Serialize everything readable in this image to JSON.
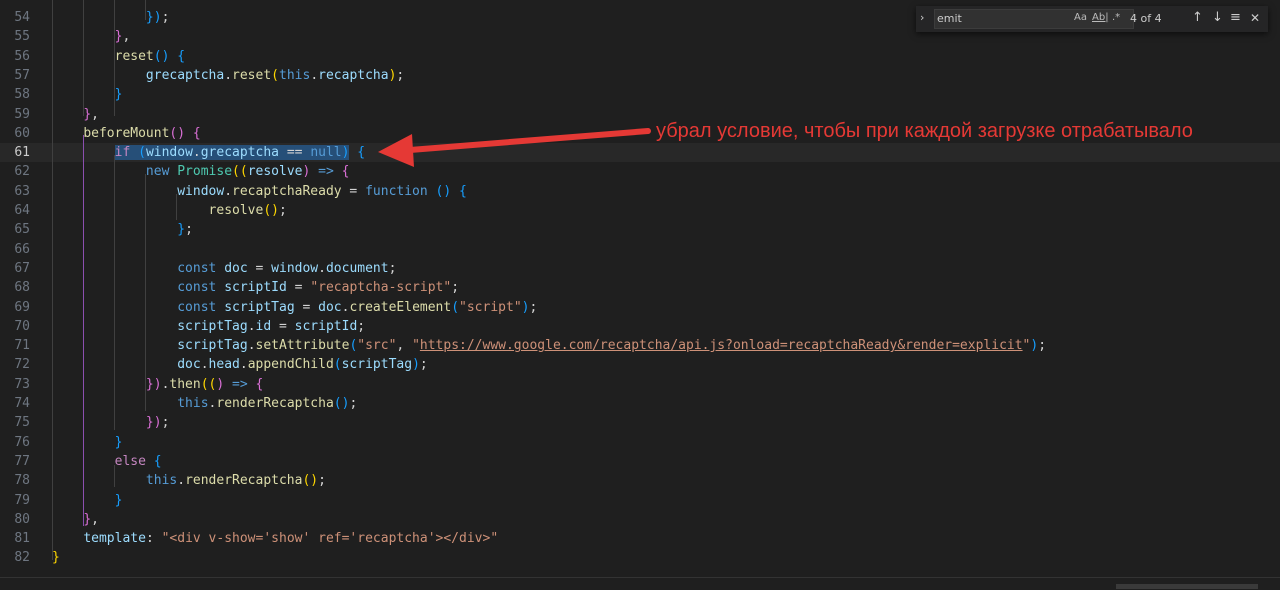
{
  "editor": {
    "lines": [
      {
        "num": "54",
        "current": false,
        "indent": 0,
        "tokens": [
          {
            "t": "            ",
            "c": ""
          },
          {
            "t": "})",
            "c": "p3"
          },
          {
            "t": ";",
            "c": ""
          }
        ]
      },
      {
        "num": "55",
        "current": false,
        "tokens": [
          {
            "t": "        ",
            "c": ""
          },
          {
            "t": "}",
            "c": "p2"
          },
          {
            "t": ",",
            "c": ""
          }
        ]
      },
      {
        "num": "56",
        "current": false,
        "tokens": [
          {
            "t": "        ",
            "c": ""
          },
          {
            "t": "reset",
            "c": "f"
          },
          {
            "t": "() ",
            "c": "p3"
          },
          {
            "t": "{",
            "c": "p3"
          }
        ]
      },
      {
        "num": "57",
        "current": false,
        "tokens": [
          {
            "t": "            ",
            "c": ""
          },
          {
            "t": "grecaptcha",
            "c": "v"
          },
          {
            "t": ".",
            "c": ""
          },
          {
            "t": "reset",
            "c": "f"
          },
          {
            "t": "(",
            "c": "p1"
          },
          {
            "t": "this",
            "c": "k"
          },
          {
            "t": ".",
            "c": ""
          },
          {
            "t": "recaptcha",
            "c": "v"
          },
          {
            "t": ")",
            "c": "p1"
          },
          {
            "t": ";",
            "c": ""
          }
        ]
      },
      {
        "num": "58",
        "current": false,
        "tokens": [
          {
            "t": "        ",
            "c": ""
          },
          {
            "t": "}",
            "c": "p3"
          }
        ]
      },
      {
        "num": "59",
        "current": false,
        "tokens": [
          {
            "t": "    ",
            "c": ""
          },
          {
            "t": "}",
            "c": "p2"
          },
          {
            "t": ",",
            "c": ""
          }
        ]
      },
      {
        "num": "60",
        "current": false,
        "tokens": [
          {
            "t": "    ",
            "c": ""
          },
          {
            "t": "beforeMount",
            "c": "f"
          },
          {
            "t": "() ",
            "c": "p2"
          },
          {
            "t": "{",
            "c": "p2"
          }
        ]
      },
      {
        "num": "61",
        "current": true,
        "tokens": [
          {
            "t": "        ",
            "c": ""
          },
          {
            "t": "if ",
            "c": "c",
            "sel": true
          },
          {
            "t": "(",
            "c": "p3",
            "sel": true
          },
          {
            "t": "window",
            "c": "v",
            "sel": true
          },
          {
            "t": ".",
            "c": "",
            "sel": true
          },
          {
            "t": "grecaptcha",
            "c": "v",
            "sel": true
          },
          {
            "t": " == ",
            "c": "",
            "sel": true
          },
          {
            "t": "null",
            "c": "k",
            "sel": true
          },
          {
            "t": ")",
            "c": "p3",
            "sel": true
          },
          {
            "t": " ",
            "c": ""
          },
          {
            "t": "{",
            "c": "p3"
          }
        ]
      },
      {
        "num": "62",
        "current": false,
        "tokens": [
          {
            "t": "            ",
            "c": ""
          },
          {
            "t": "new ",
            "c": "k"
          },
          {
            "t": "Promise",
            "c": "t"
          },
          {
            "t": "((",
            "c": "p1"
          },
          {
            "t": "resolve",
            "c": "v"
          },
          {
            "t": ")",
            "c": "p2"
          },
          {
            "t": " ",
            "c": ""
          },
          {
            "t": "=>",
            "c": "k"
          },
          {
            "t": " ",
            "c": ""
          },
          {
            "t": "{",
            "c": "p2"
          }
        ]
      },
      {
        "num": "63",
        "current": false,
        "tokens": [
          {
            "t": "                ",
            "c": ""
          },
          {
            "t": "window",
            "c": "v"
          },
          {
            "t": ".",
            "c": ""
          },
          {
            "t": "recaptchaReady",
            "c": "f"
          },
          {
            "t": " = ",
            "c": ""
          },
          {
            "t": "function",
            "c": "k"
          },
          {
            "t": " ",
            "c": ""
          },
          {
            "t": "() ",
            "c": "p3"
          },
          {
            "t": "{",
            "c": "p3"
          }
        ]
      },
      {
        "num": "64",
        "current": false,
        "tokens": [
          {
            "t": "                    ",
            "c": ""
          },
          {
            "t": "resolve",
            "c": "f"
          },
          {
            "t": "()",
            "c": "p1"
          },
          {
            "t": ";",
            "c": ""
          }
        ]
      },
      {
        "num": "65",
        "current": false,
        "tokens": [
          {
            "t": "                ",
            "c": ""
          },
          {
            "t": "}",
            "c": "p3"
          },
          {
            "t": ";",
            "c": ""
          }
        ]
      },
      {
        "num": "66",
        "current": false,
        "tokens": []
      },
      {
        "num": "67",
        "current": false,
        "tokens": [
          {
            "t": "                ",
            "c": ""
          },
          {
            "t": "const ",
            "c": "k"
          },
          {
            "t": "doc",
            "c": "v"
          },
          {
            "t": " = ",
            "c": ""
          },
          {
            "t": "window",
            "c": "v"
          },
          {
            "t": ".",
            "c": ""
          },
          {
            "t": "document",
            "c": "v"
          },
          {
            "t": ";",
            "c": ""
          }
        ]
      },
      {
        "num": "68",
        "current": false,
        "tokens": [
          {
            "t": "                ",
            "c": ""
          },
          {
            "t": "const ",
            "c": "k"
          },
          {
            "t": "scriptId",
            "c": "v"
          },
          {
            "t": " = ",
            "c": ""
          },
          {
            "t": "\"recaptcha-script\"",
            "c": "s"
          },
          {
            "t": ";",
            "c": ""
          }
        ]
      },
      {
        "num": "69",
        "current": false,
        "tokens": [
          {
            "t": "                ",
            "c": ""
          },
          {
            "t": "const ",
            "c": "k"
          },
          {
            "t": "scriptTag",
            "c": "v"
          },
          {
            "t": " = ",
            "c": ""
          },
          {
            "t": "doc",
            "c": "v"
          },
          {
            "t": ".",
            "c": ""
          },
          {
            "t": "createElement",
            "c": "f"
          },
          {
            "t": "(",
            "c": "p3"
          },
          {
            "t": "\"script\"",
            "c": "s"
          },
          {
            "t": ")",
            "c": "p3"
          },
          {
            "t": ";",
            "c": ""
          }
        ]
      },
      {
        "num": "70",
        "current": false,
        "tokens": [
          {
            "t": "                ",
            "c": ""
          },
          {
            "t": "scriptTag",
            "c": "v"
          },
          {
            "t": ".",
            "c": ""
          },
          {
            "t": "id",
            "c": "v"
          },
          {
            "t": " = ",
            "c": ""
          },
          {
            "t": "scriptId",
            "c": "v"
          },
          {
            "t": ";",
            "c": ""
          }
        ]
      },
      {
        "num": "71",
        "current": false,
        "tokens": [
          {
            "t": "                ",
            "c": ""
          },
          {
            "t": "scriptTag",
            "c": "v"
          },
          {
            "t": ".",
            "c": ""
          },
          {
            "t": "setAttribute",
            "c": "f"
          },
          {
            "t": "(",
            "c": "p3"
          },
          {
            "t": "\"src\"",
            "c": "s"
          },
          {
            "t": ", ",
            "c": ""
          },
          {
            "t": "\"",
            "c": "s"
          },
          {
            "t": "https://www.google.com/recaptcha/api.js?onload=recaptchaReady&render=explicit",
            "c": "s",
            "u": true
          },
          {
            "t": "\"",
            "c": "s"
          },
          {
            "t": ")",
            "c": "p3"
          },
          {
            "t": ";",
            "c": ""
          }
        ]
      },
      {
        "num": "72",
        "current": false,
        "tokens": [
          {
            "t": "                ",
            "c": ""
          },
          {
            "t": "doc",
            "c": "v"
          },
          {
            "t": ".",
            "c": ""
          },
          {
            "t": "head",
            "c": "v"
          },
          {
            "t": ".",
            "c": ""
          },
          {
            "t": "appendChild",
            "c": "f"
          },
          {
            "t": "(",
            "c": "p3"
          },
          {
            "t": "scriptTag",
            "c": "v"
          },
          {
            "t": ")",
            "c": "p3"
          },
          {
            "t": ";",
            "c": ""
          }
        ]
      },
      {
        "num": "73",
        "current": false,
        "tokens": [
          {
            "t": "            ",
            "c": ""
          },
          {
            "t": "})",
            "c": "p2"
          },
          {
            "t": ".",
            "c": ""
          },
          {
            "t": "then",
            "c": "f"
          },
          {
            "t": "((",
            "c": "p1"
          },
          {
            "t": ")",
            "c": "p2"
          },
          {
            "t": " ",
            "c": ""
          },
          {
            "t": "=>",
            "c": "k"
          },
          {
            "t": " ",
            "c": ""
          },
          {
            "t": "{",
            "c": "p2"
          }
        ]
      },
      {
        "num": "74",
        "current": false,
        "tokens": [
          {
            "t": "                ",
            "c": ""
          },
          {
            "t": "this",
            "c": "k"
          },
          {
            "t": ".",
            "c": ""
          },
          {
            "t": "renderRecaptcha",
            "c": "f"
          },
          {
            "t": "()",
            "c": "p3"
          },
          {
            "t": ";",
            "c": ""
          }
        ]
      },
      {
        "num": "75",
        "current": false,
        "tokens": [
          {
            "t": "            ",
            "c": ""
          },
          {
            "t": "})",
            "c": "p2"
          },
          {
            "t": ";",
            "c": ""
          }
        ]
      },
      {
        "num": "76",
        "current": false,
        "tokens": [
          {
            "t": "        ",
            "c": ""
          },
          {
            "t": "}",
            "c": "p3"
          }
        ]
      },
      {
        "num": "77",
        "current": false,
        "tokens": [
          {
            "t": "        ",
            "c": ""
          },
          {
            "t": "else ",
            "c": "c"
          },
          {
            "t": "{",
            "c": "p3"
          }
        ]
      },
      {
        "num": "78",
        "current": false,
        "tokens": [
          {
            "t": "            ",
            "c": ""
          },
          {
            "t": "this",
            "c": "k"
          },
          {
            "t": ".",
            "c": ""
          },
          {
            "t": "renderRecaptcha",
            "c": "f"
          },
          {
            "t": "()",
            "c": "p1"
          },
          {
            "t": ";",
            "c": ""
          }
        ]
      },
      {
        "num": "79",
        "current": false,
        "tokens": [
          {
            "t": "        ",
            "c": ""
          },
          {
            "t": "}",
            "c": "p3"
          }
        ]
      },
      {
        "num": "80",
        "current": false,
        "tokens": [
          {
            "t": "    ",
            "c": ""
          },
          {
            "t": "}",
            "c": "p2"
          },
          {
            "t": ",",
            "c": ""
          }
        ]
      },
      {
        "num": "81",
        "current": false,
        "tokens": [
          {
            "t": "    ",
            "c": ""
          },
          {
            "t": "template",
            "c": "v"
          },
          {
            "t": ": ",
            "c": ""
          },
          {
            "t": "\"<div v-show='show' ref='recaptcha'></div>\"",
            "c": "s"
          }
        ]
      },
      {
        "num": "82",
        "current": false,
        "tokens": [
          {
            "t": "}",
            "c": "p1"
          }
        ]
      }
    ]
  },
  "find": {
    "query": "emit",
    "match_case_label": "Aa",
    "whole_word_label": "Ab|",
    "regex_label": ".*",
    "count": "4 of 4",
    "toggle_glyph": "›",
    "prev_glyph": "↑",
    "next_glyph": "↓",
    "selection_glyph": "≡",
    "close_glyph": "✕"
  },
  "annotation": {
    "text": "убрал условие, чтобы при каждой загрузке отрабатывало",
    "color": "#e53935"
  }
}
